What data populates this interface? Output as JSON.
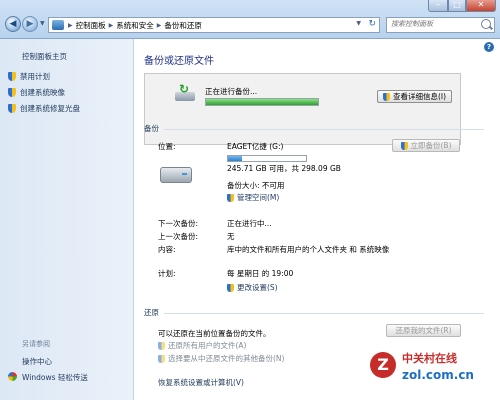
{
  "window": {
    "minimize": "–",
    "maximize": "□",
    "close": "✕"
  },
  "nav": {
    "back": "◀",
    "forward": "▶"
  },
  "address": {
    "crumbs": [
      "控制面板",
      "系统和安全",
      "备份和还原"
    ]
  },
  "search": {
    "placeholder": "搜索控制面板"
  },
  "sidebar": {
    "home": "控制面板主页",
    "items": [
      {
        "label": "禁用计划",
        "icon": "shield-icon"
      },
      {
        "label": "创建系统映像",
        "icon": "shield-icon"
      },
      {
        "label": "创建系统修复光盘",
        "icon": "shield-icon"
      }
    ],
    "see_also": "另请参阅",
    "links": [
      "操作中心",
      "Windows 轻松传送"
    ]
  },
  "main": {
    "title": "备份或还原文件",
    "progress": {
      "status": "正在进行备份...",
      "percent": 100,
      "details_button": "查看详细信息(I)"
    },
    "backup_section": "备份",
    "location_label": "位置:",
    "drive_name": "EAGET亿捷 (G:)",
    "drive_used_fraction": 0.18,
    "drive_space": "245.71 GB 可用，共 298.09 GB",
    "backup_size": "备份大小: 不可用",
    "manage_space": "管理空间(M)",
    "backup_now_button": "立即备份(B)",
    "rows": [
      {
        "label": "下一次备份:",
        "value": "正在进行中..."
      },
      {
        "label": "上一次备份:",
        "value": "无"
      },
      {
        "label": "内容:",
        "value": "库中的文件和所有用户的个人文件夹 和 系统映像"
      },
      {
        "label": "计划:",
        "value": "每 星期日 的 19:00"
      }
    ],
    "change_settings": "更改设置(S)",
    "restore_section": "还原",
    "restore_text": "可以还原在当前位置备份的文件。",
    "restore_button": "还原我的文件(R)",
    "restore_all_users": "还原所有用户的文件(A)",
    "select_other_backup": "选择要从中还原文件的其他备份(N)",
    "recover_link": "恢复系统设置或计算机(V)"
  },
  "watermark": {
    "logo_letter": "Z",
    "cn": "中关村在线",
    "site": "zol.com.cn"
  }
}
